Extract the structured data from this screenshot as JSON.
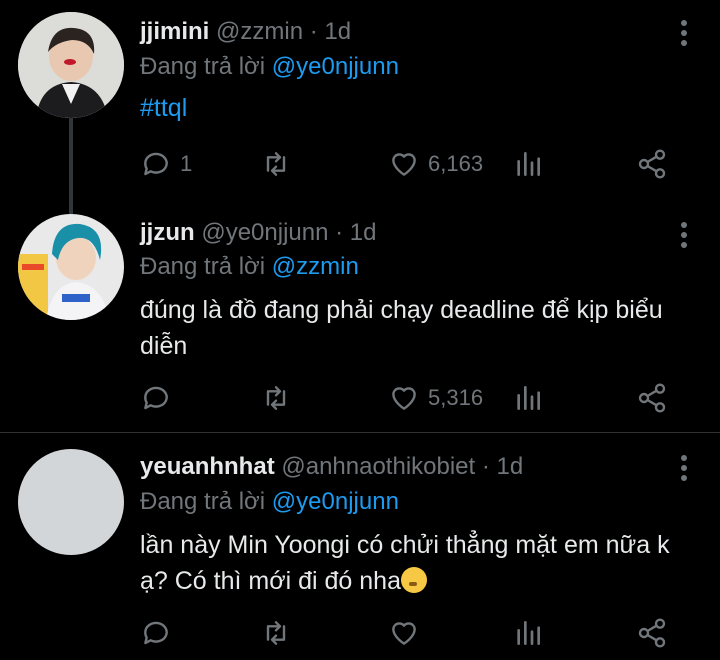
{
  "tweets": [
    {
      "name": "jjimini",
      "handle": "@zzmin",
      "time": "· 1d",
      "replying_prefix": "Đang trả lời ",
      "replying_to": "@ye0njjunn",
      "text": "#ttql",
      "replies": "1",
      "retweets": "",
      "likes": "6,163"
    },
    {
      "name": "jjzun",
      "handle": "@ye0njjunn",
      "time": "· 1d",
      "replying_prefix": "Đang trả lời ",
      "replying_to": "@zzmin",
      "text": "đúng là đồ đang phải chạy deadline để kịp biểu diễn",
      "replies": "",
      "retweets": "",
      "likes": "5,316"
    },
    {
      "name": "yeuanhnhat",
      "handle": "@anhnaothikobiet",
      "time": "· 1d",
      "replying_prefix": "Đang trả lời ",
      "replying_to": "@ye0njjunn",
      "text": "lần này Min Yoongi có chửi thẳng mặt em nữa k ạ? Có thì mới đi đó nha",
      "emoji": "shushing-face-emoji",
      "replies": "",
      "retweets": "",
      "likes": ""
    }
  ],
  "colors": {
    "background": "#000000",
    "text": "#e7e9ea",
    "muted": "#71767b",
    "link": "#1d9bf0",
    "divider": "#2f3336"
  }
}
